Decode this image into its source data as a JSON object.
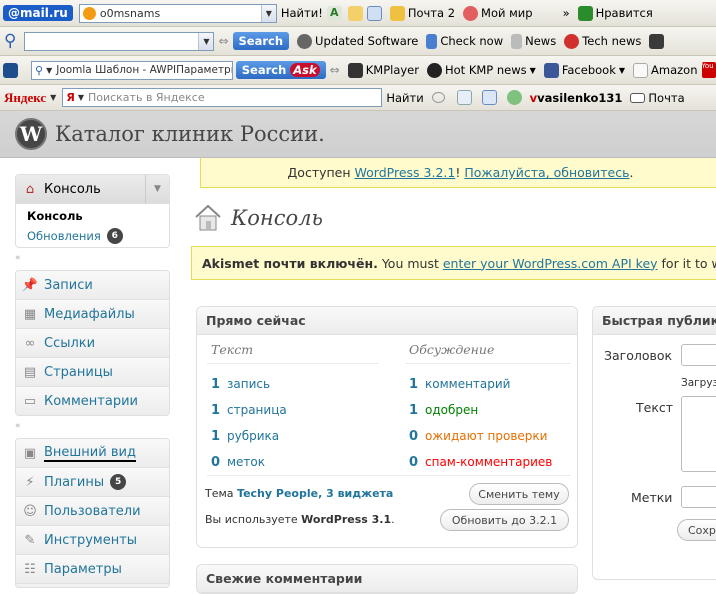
{
  "toolbar1": {
    "mailru": "@mail.ru",
    "search_value": "o0msnams",
    "find": "Найти!",
    "mail": "Почта 2",
    "myworld": "Мой мир",
    "more": "»",
    "like": "Нравится"
  },
  "toolbar2": {
    "search_btn": "Search",
    "updated": "Updated Software",
    "checknow": "Check now",
    "news": "News",
    "technews": "Tech news"
  },
  "toolbar3": {
    "ask_value": "Joomla Шаблон - AWPIПараметры",
    "search_btn": "Search",
    "ask": "Ask",
    "kmplayer": "KMPlayer",
    "hotkmp": "Hot KMP news",
    "facebook": "Facebook",
    "amazon": "Amazon",
    "youtube": "You Tube"
  },
  "toolbar4": {
    "yandex": "Яндекс",
    "placeholder": "Поискать в Яндексе",
    "find": "Найти",
    "user": "vasilenko131",
    "mail": "Почта"
  },
  "header": {
    "site_title": "Каталог клиник России."
  },
  "update_notice": {
    "prefix": "Доступен ",
    "version_link": "WordPress 3.2.1",
    "mid": "! ",
    "update_link": "Пожалуйста, обновитесь",
    "suffix": "."
  },
  "page_title": "Консоль",
  "akismet": {
    "bold": "Akismet почти включён.",
    "text": " You must ",
    "link": "enter your WordPress.com API key",
    "suffix": " for it to work."
  },
  "menu": {
    "console_header": "Консоль",
    "console_sub": "Консоль",
    "updates": "Обновления",
    "updates_count": "6",
    "group1": [
      "Записи",
      "Медиафайлы",
      "Ссылки",
      "Страницы",
      "Комментарии"
    ],
    "appearance": "Внешний вид",
    "plugins": "Плагины",
    "plugins_count": "5",
    "users": "Пользователи",
    "tools": "Инструменты",
    "settings": "Параметры"
  },
  "right_now": {
    "title": "Прямо сейчас",
    "col_text": "Текст",
    "col_discussion": "Обсуждение",
    "content": [
      {
        "n": "1",
        "label": "запись"
      },
      {
        "n": "1",
        "label": "страница"
      },
      {
        "n": "1",
        "label": "рубрика"
      },
      {
        "n": "0",
        "label": "меток"
      }
    ],
    "discussion": [
      {
        "n": "1",
        "label": "комментарий",
        "color": "#21759b"
      },
      {
        "n": "1",
        "label": "одобрен",
        "color": "#008000"
      },
      {
        "n": "0",
        "label": "ожидают проверки",
        "color": "#e66f00"
      },
      {
        "n": "0",
        "label": "спам-комментариев",
        "color": "#ff0000"
      }
    ],
    "theme_prefix": "Тема ",
    "theme_link": "Techy People",
    "theme_sep": ", ",
    "widgets_link": "3 виджета",
    "change_theme": "Сменить тему",
    "version_prefix": "Вы используете ",
    "version": "WordPress 3.1",
    "upgrade": "Обновить до 3.2.1"
  },
  "quick_press": {
    "title": "Быстрая публикация",
    "heading_label": "Заголовок",
    "upload": "Загрузить",
    "text_label": "Текст",
    "tags_label": "Метки",
    "save": "Сохранить"
  },
  "recent_comments": {
    "title": "Свежие комментарии"
  }
}
